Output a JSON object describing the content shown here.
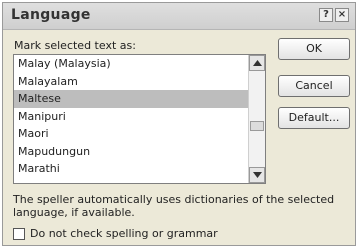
{
  "dialog": {
    "title": "Language",
    "help_glyph": "?",
    "close_glyph": "×",
    "prompt": "Mark selected text as:",
    "languages": [
      {
        "label": "Malay (Malaysia)",
        "selected": false
      },
      {
        "label": "Malayalam",
        "selected": false
      },
      {
        "label": "Maltese",
        "selected": true
      },
      {
        "label": "Manipuri",
        "selected": false
      },
      {
        "label": "Maori",
        "selected": false
      },
      {
        "label": "Mapudungun",
        "selected": false
      },
      {
        "label": "Marathi",
        "selected": false
      }
    ],
    "ok_label": "OK",
    "cancel_label": "Cancel",
    "default_label": "Default...",
    "note": "The speller automatically uses dictionaries of the selected language, if available.",
    "checkbox_label": "Do not check spelling or grammar",
    "checkbox_checked": false
  }
}
